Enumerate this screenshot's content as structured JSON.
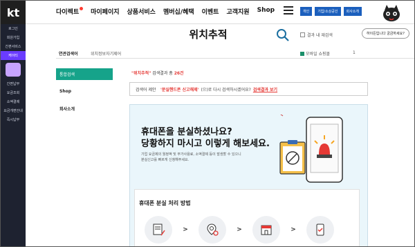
{
  "header": {
    "logo": "kt",
    "nav": [
      "다이렉트",
      "마이페이지",
      "상품서비스",
      "멤버십/혜택",
      "이벤트",
      "고객지원",
      "Shop"
    ],
    "buttons": [
      "개인",
      "기업/소상공인",
      "회사소개"
    ],
    "speech": "하이든입니다 궁금하세요?"
  },
  "left_nav": {
    "items": [
      "로그인",
      "회원가입",
      "간편서비스",
      "케이티",
      "간편납부",
      "요금조회",
      "소액결제",
      "요금개편안내",
      "즉시납부"
    ]
  },
  "page": {
    "title": "위치추적",
    "refine_label": "결과 내 재검색"
  },
  "tabs": {
    "related": "연관검색어",
    "keyword": "위치정보자기제어",
    "right1": "모바일 쇼핑몰",
    "right2": "1"
  },
  "categories": [
    {
      "label": "통합검색",
      "selected": true
    },
    {
      "label": "Shop",
      "selected": false
    },
    {
      "label": "회사소개",
      "selected": false
    }
  ],
  "results": {
    "query": "\"위치추적\"",
    "count_text": "검색결과 총",
    "count": "26건",
    "suggest_label": "검색어 제안",
    "suggest_term": "'분실핸드폰 신고해제'",
    "suggest_mid": "(으)로 다시 검색하시겠어요?",
    "suggest_link": "검색결과 보기"
  },
  "promo": {
    "heading_line1": "휴대폰을 분실하셨나요?",
    "heading_line2": "당황하지 마시고 이렇게 해보세요.",
    "desc_line1": "기업 요금제의 월정액 및 부가사용료, 소액결제 등이 발생할 수 있으니",
    "desc_line2": "분실신고를 빠르게 신청해주세요.",
    "panel_title": "휴대폰 분실 처리 방법",
    "steps": [
      "document-pen-icon",
      "location-search-icon",
      "store-icon",
      "phone-check-icon"
    ]
  },
  "colors": {
    "accent_blue": "#1b5fbd",
    "teal": "#16a38a",
    "red": "#e53935",
    "sidebar_bg": "#1e2230",
    "purple": "#6a3cff"
  }
}
